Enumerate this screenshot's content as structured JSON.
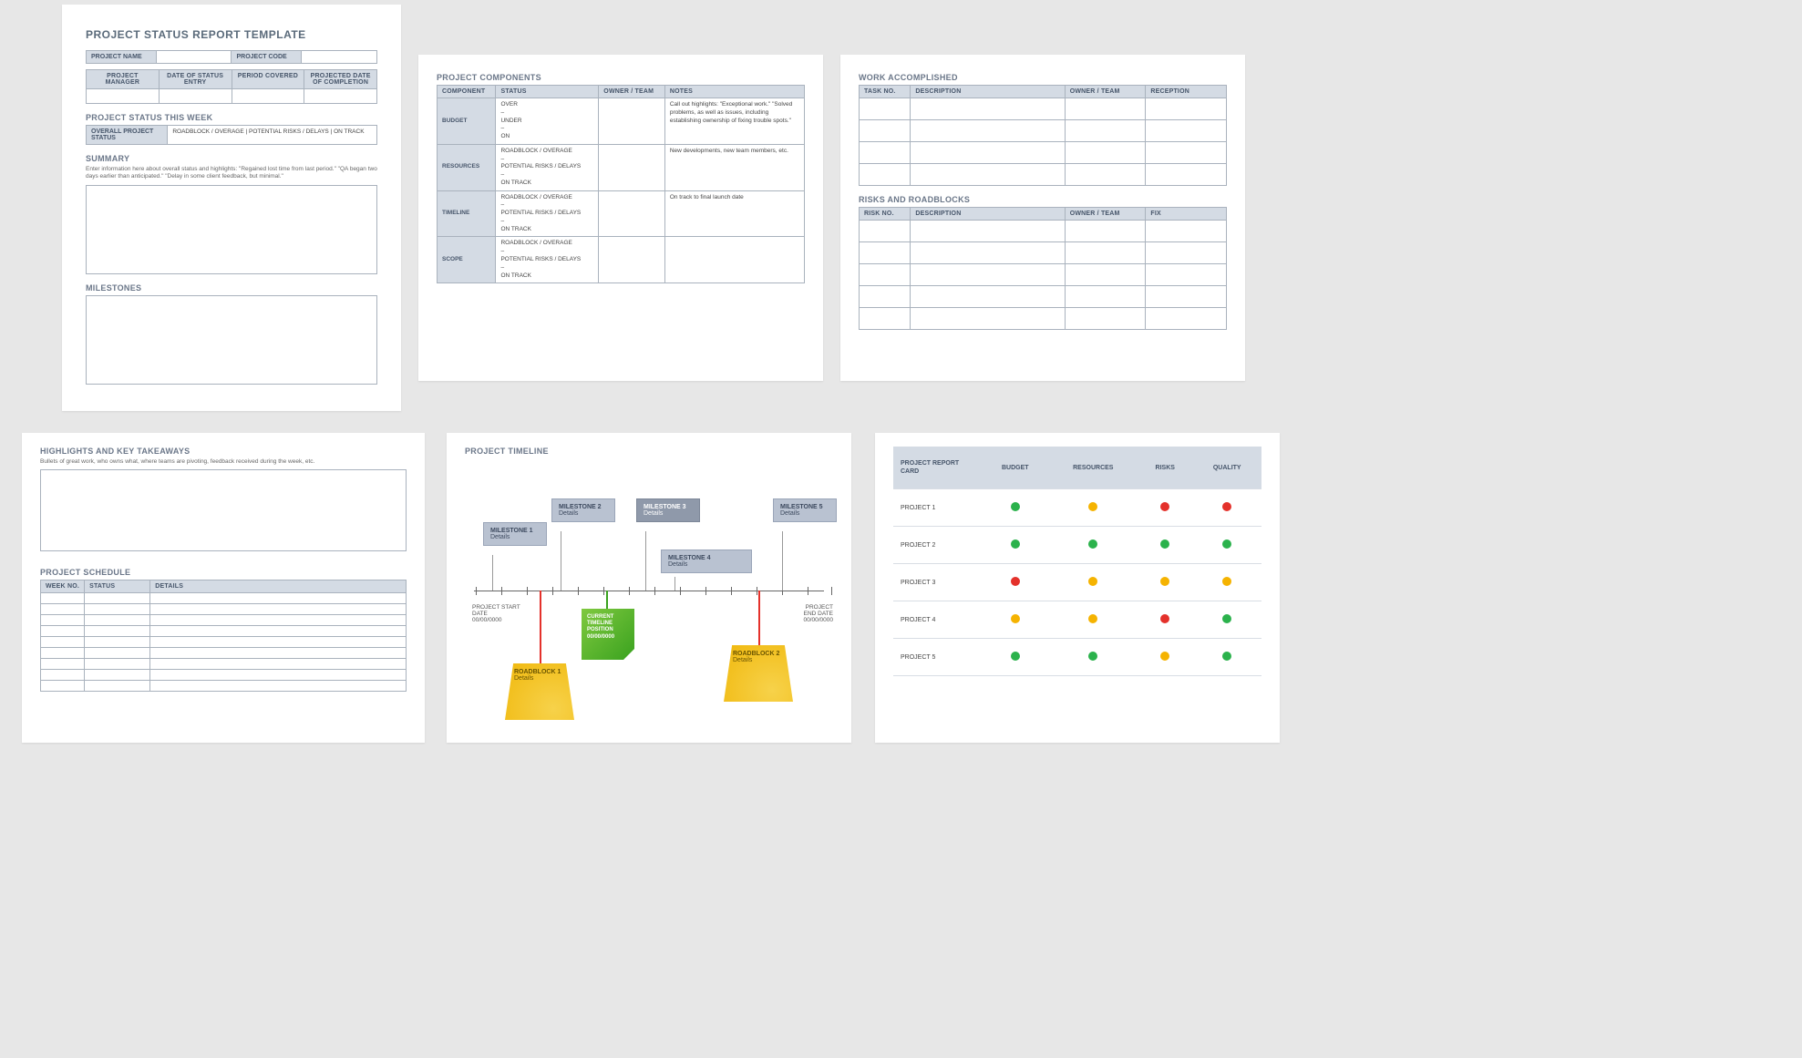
{
  "page1": {
    "title": "PROJECT STATUS REPORT TEMPLATE",
    "meta1": {
      "c1": "PROJECT NAME",
      "c2": "PROJECT CODE"
    },
    "meta2": {
      "c1": "PROJECT MANAGER",
      "c2": "DATE OF STATUS ENTRY",
      "c3": "PERIOD COVERED",
      "c4": "PROJECTED DATE OF COMPLETION"
    },
    "status_week": "PROJECT STATUS THIS WEEK",
    "status_row": {
      "label": "OVERALL PROJECT STATUS",
      "opts": "ROADBLOCK / OVERAGE   |   POTENTIAL RISKS / DELAYS   |   ON TRACK"
    },
    "summary": "SUMMARY",
    "summary_hint": "Enter information here about overall status and highlights: \"Regained lost time from last period.\" \"QA began two days earlier than anticipated.\" \"Delay in some client feedback, but minimal.\"",
    "milestones": "MILESTONES"
  },
  "page2": {
    "title": "PROJECT COMPONENTS",
    "headers": [
      "COMPONENT",
      "STATUS",
      "OWNER / TEAM",
      "NOTES"
    ],
    "rows": [
      {
        "name": "BUDGET",
        "status": "OVER\n–\nUNDER\n–\nON",
        "notes": "Call out highlights:  \"Exceptional work.\"  \"Solved problems, as well as issues, including establishing ownership of fixing trouble spots.\""
      },
      {
        "name": "RESOURCES",
        "status": "ROADBLOCK / OVERAGE\n–\nPOTENTIAL RISKS / DELAYS\n–\nON TRACK",
        "notes": "New developments, new team members, etc."
      },
      {
        "name": "TIMELINE",
        "status": "ROADBLOCK / OVERAGE\n–\nPOTENTIAL RISKS / DELAYS\n–\nON TRACK",
        "notes": "On track to final launch date"
      },
      {
        "name": "SCOPE",
        "status": "ROADBLOCK / OVERAGE\n–\nPOTENTIAL RISKS / DELAYS\n–\nON TRACK",
        "notes": ""
      }
    ]
  },
  "page3": {
    "wa_title": "WORK ACCOMPLISHED",
    "wa_headers": [
      "TASK NO.",
      "DESCRIPTION",
      "OWNER / TEAM",
      "RECEPTION"
    ],
    "rr_title": "RISKS AND ROADBLOCKS",
    "rr_headers": [
      "RISK NO.",
      "DESCRIPTION",
      "OWNER / TEAM",
      "FIX"
    ]
  },
  "page4": {
    "hi_title": "HIGHLIGHTS AND KEY TAKEAWAYS",
    "hi_hint": "Bullets of great work, who owns what, where teams are pivoting, feedback received during the week, etc.",
    "ps_title": "PROJECT SCHEDULE",
    "ps_headers": [
      "WEEK NO.",
      "STATUS",
      "DETAILS"
    ]
  },
  "page5": {
    "title": "PROJECT TIMELINE",
    "start": {
      "l1": "PROJECT START",
      "l2": "DATE",
      "l3": "00/00/0000"
    },
    "end": {
      "l1": "PROJECT",
      "l2": "END DATE",
      "l3": "00/00/0000"
    },
    "ms1": {
      "t": "MILESTONE 1",
      "d": "Details"
    },
    "ms2": {
      "t": "MILESTONE 2",
      "d": "Details"
    },
    "ms3": {
      "t": "MILESTONE 3",
      "d": "Details"
    },
    "ms4": {
      "t": "MILESTONE 4",
      "d": "Details"
    },
    "ms5": {
      "t": "MILESTONE 5",
      "d": "Details"
    },
    "rb1": {
      "t": "ROADBLOCK 1",
      "d": "Details"
    },
    "rb2": {
      "t": "ROADBLOCK 2",
      "d": "Details"
    },
    "cur": {
      "l1": "CURRENT",
      "l2": "TIMELINE",
      "l3": "POSITION",
      "l4": "00/00/0000"
    }
  },
  "page6": {
    "headers": [
      "PROJECT REPORT CARD",
      "BUDGET",
      "RESOURCES",
      "RISKS",
      "QUALITY"
    ],
    "rows": [
      {
        "name": "PROJECT 1",
        "cells": [
          "g",
          "y",
          "r",
          "r"
        ]
      },
      {
        "name": "PROJECT 2",
        "cells": [
          "g",
          "g",
          "g",
          "g"
        ]
      },
      {
        "name": "PROJECT 3",
        "cells": [
          "r",
          "y",
          "y",
          "y"
        ]
      },
      {
        "name": "PROJECT 4",
        "cells": [
          "y",
          "y",
          "r",
          "g"
        ]
      },
      {
        "name": "PROJECT 5",
        "cells": [
          "g",
          "g",
          "y",
          "g"
        ]
      }
    ]
  }
}
